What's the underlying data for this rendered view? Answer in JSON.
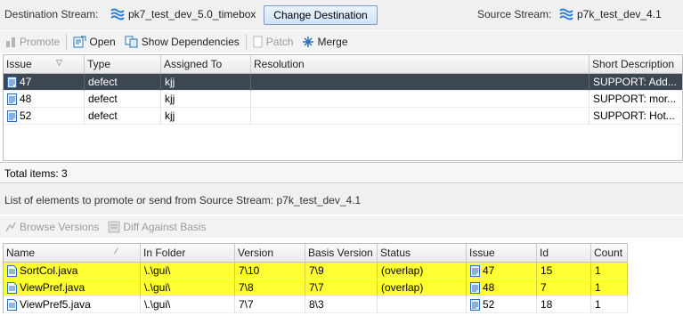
{
  "header": {
    "destination_label": "Destination Stream:",
    "destination_stream": "pk7_test_dev_5.0_timebox",
    "change_button": "Change Destination",
    "source_label": "Source Stream:",
    "source_stream": "p7k_test_dev_4.1"
  },
  "toolbar1": {
    "promote": "Promote",
    "open": "Open",
    "show_dependencies": "Show Dependencies",
    "patch": "Patch",
    "merge": "Merge"
  },
  "issues_table": {
    "columns": [
      "Issue",
      "Type",
      "Assigned To",
      "Resolution",
      "Short Description"
    ],
    "rows": [
      {
        "issue": "47",
        "type": "defect",
        "assigned": "kjj",
        "resolution": "",
        "desc": "SUPPORT: Add..."
      },
      {
        "issue": "48",
        "type": "defect",
        "assigned": "kjj",
        "resolution": "",
        "desc": "SUPPORT: mor..."
      },
      {
        "issue": "52",
        "type": "defect",
        "assigned": "kjj",
        "resolution": "",
        "desc": "SUPPORT: Hot..."
      }
    ]
  },
  "total_items": "Total items: 3",
  "elements_title": "List of elements to promote or send from Source Stream: p7k_test_dev_4.1",
  "toolbar2": {
    "browse_versions": "Browse Versions",
    "diff_against_basis": "Diff Against Basis"
  },
  "elements_table": {
    "columns": [
      "Name",
      "In Folder",
      "Version",
      "Basis Version",
      "Status",
      "Issue",
      "Id",
      "Count"
    ],
    "rows": [
      {
        "name": "SortCol.java",
        "folder": "\\.\\gui\\",
        "version": "7\\10",
        "basis": "7\\9",
        "status": "(overlap)",
        "issue": "47",
        "id": "15",
        "count": "1"
      },
      {
        "name": "ViewPref.java",
        "folder": "\\.\\gui\\",
        "version": "7\\8",
        "basis": "7\\7",
        "status": "(overlap)",
        "issue": "48",
        "id": "7",
        "count": "1"
      },
      {
        "name": "ViewPref5.java",
        "folder": "\\.\\gui\\",
        "version": "7\\7",
        "basis": "8\\3",
        "status": "",
        "issue": "52",
        "id": "18",
        "count": "1"
      }
    ]
  },
  "colors": {
    "selected_row": "#3d4752",
    "overlap_highlight": "#ffff33",
    "stream_icon": "#2f7fd0"
  },
  "icons": [
    "stream-icon",
    "promote-icon",
    "open-icon",
    "dependencies-icon",
    "patch-icon",
    "merge-icon",
    "issue-icon",
    "file-icon",
    "browse-versions-icon",
    "diff-icon"
  ]
}
